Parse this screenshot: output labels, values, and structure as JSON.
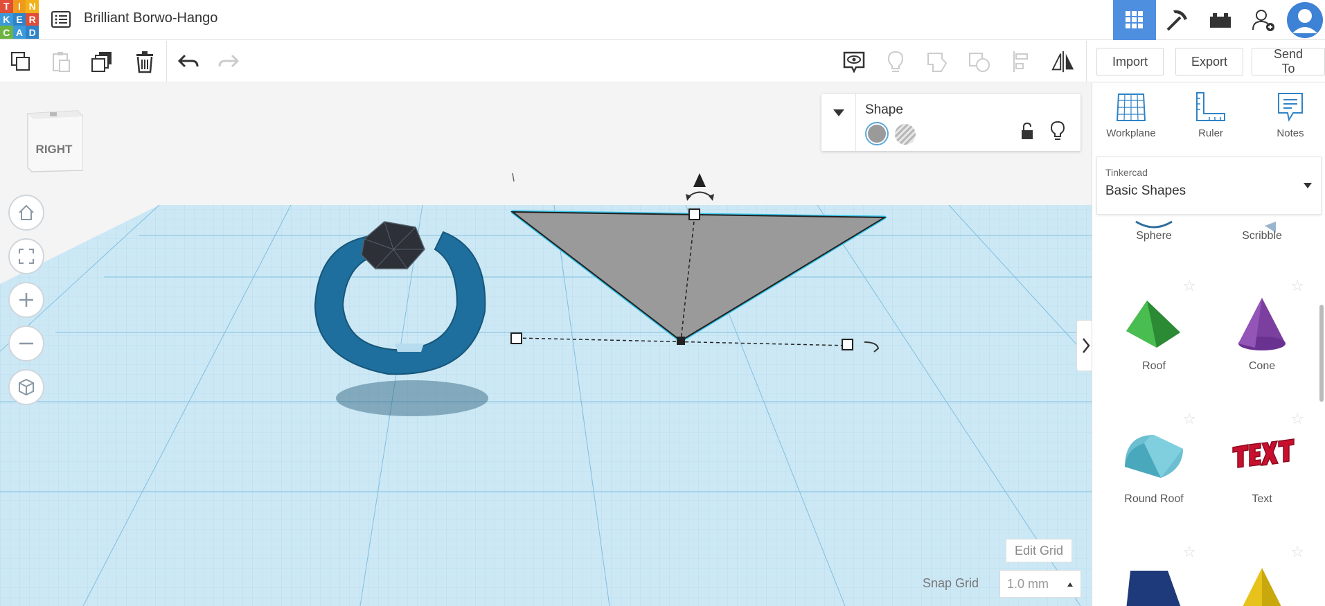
{
  "app": {
    "logo_letters": [
      "T",
      "I",
      "N",
      "K",
      "E",
      "R",
      "C",
      "A",
      "D"
    ],
    "logo_colors": [
      "#e04e39",
      "#f09a1c",
      "#f2b21c",
      "#3b9ad9",
      "#2f83c7",
      "#e04e39",
      "#6cb33f",
      "#3b9ad9",
      "#2f83c7"
    ],
    "project_title": "Brilliant Borwo-Hango"
  },
  "toolbar": {
    "import_label": "Import",
    "export_label": "Export",
    "send_to_label": "Send To"
  },
  "viewcube": {
    "face_label": "RIGHT"
  },
  "shape_panel": {
    "title": "Shape"
  },
  "grid": {
    "edit_grid_label": "Edit Grid",
    "snap_grid_label": "Snap Grid",
    "snap_grid_value": "1.0 mm"
  },
  "sidebar": {
    "tools": {
      "workplane": "Workplane",
      "ruler": "Ruler",
      "notes": "Notes"
    },
    "library": {
      "provider": "Tinkercad",
      "category": "Basic Shapes"
    },
    "shapes": [
      {
        "label": "Sphere"
      },
      {
        "label": "Scribble"
      },
      {
        "label": "Roof"
      },
      {
        "label": "Cone"
      },
      {
        "label": "Round Roof"
      },
      {
        "label": "Text"
      }
    ]
  },
  "colors": {
    "accent": "#4f8fe0",
    "workplane": "#cde8f5",
    "ring": "#1e6f9e",
    "selected_shape": "#9a9a9a",
    "selection_outline": "#31c3e8"
  }
}
